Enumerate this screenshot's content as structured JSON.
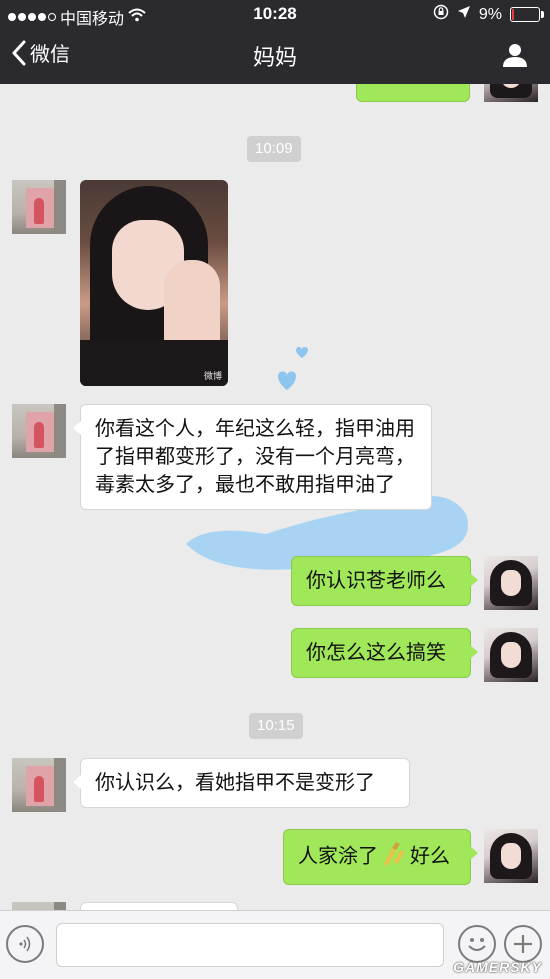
{
  "status_bar": {
    "carrier": "中国移动",
    "time": "10:28",
    "battery_percent": "9%",
    "battery_level": 0.09,
    "battery_color": "#e83b3b",
    "icons": [
      "signal-dots",
      "wifi-icon",
      "rotation-lock-icon",
      "location-arrow-icon",
      "battery-icon"
    ]
  },
  "nav": {
    "back_label": "微信",
    "title": "妈妈",
    "right_icon": "person-icon"
  },
  "chat": {
    "timestamps": [
      "10:09",
      "10:15"
    ],
    "messages": [
      {
        "side": "left",
        "type": "image",
        "sender": "mom",
        "image_watermark": "微博"
      },
      {
        "side": "left",
        "type": "text",
        "sender": "mom",
        "text": "你看这个人，年纪这么轻，指甲油用了指甲都变形了，没有一个月亮弯，毒素太多了，最也不敢用指甲油了"
      },
      {
        "side": "right",
        "type": "text",
        "sender": "me",
        "text": "你认识苍老师么"
      },
      {
        "side": "right",
        "type": "text",
        "sender": "me",
        "text": "你怎么这么搞笑"
      },
      {
        "side": "left",
        "type": "text",
        "sender": "mom",
        "text": "你认识么，看她指甲不是变形了"
      },
      {
        "side": "right",
        "type": "text",
        "sender": "me",
        "text_before": "人家涂了",
        "emoji": "nail-polish-emoji",
        "text_after": "好么"
      }
    ],
    "bubble_colors": {
      "mine": "#a0e75a",
      "theirs": "#ffffff"
    }
  },
  "input_bar": {
    "icons": [
      "voice-icon",
      "emoji-icon",
      "plus-icon"
    ]
  },
  "watermark": "GAMERSKY"
}
